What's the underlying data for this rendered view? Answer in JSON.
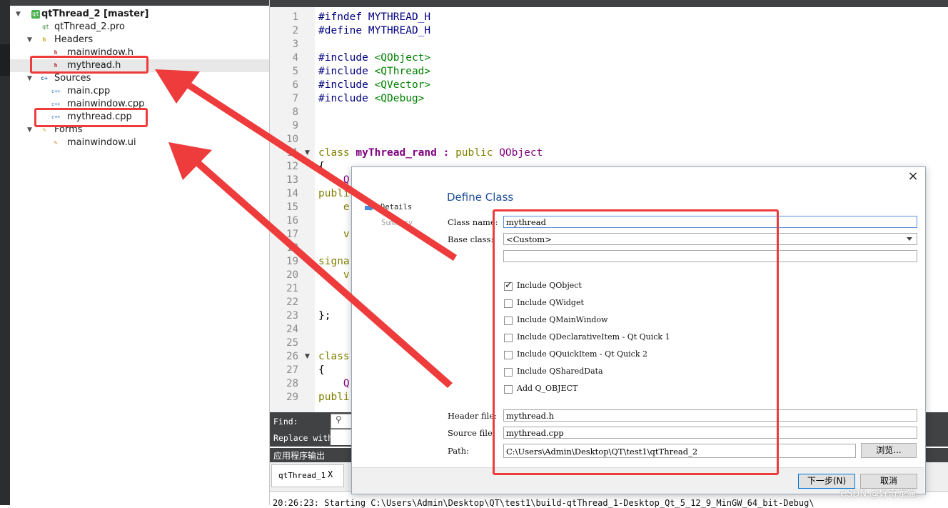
{
  "project_tree": {
    "root": "qtThread_2 [master]",
    "pro_file": "qtThread_2.pro",
    "headers_folder": "Headers",
    "headers": [
      "mainwindow.h",
      "mythread.h"
    ],
    "sources_folder": "Sources",
    "sources": [
      "main.cpp",
      "mainwindow.cpp",
      "mythread.cpp"
    ],
    "forms_folder": "Forms",
    "forms": [
      "mainwindow.ui"
    ]
  },
  "editor": {
    "line_numbers": [
      "1",
      "2",
      "3",
      "4",
      "5",
      "6",
      "7",
      "8",
      "9",
      "10",
      "11",
      "12",
      "13",
      "14",
      "15",
      "16",
      "17",
      "18",
      "19",
      "20",
      "21",
      "22",
      "23",
      "24",
      "25",
      "26",
      "27",
      "28",
      "29"
    ],
    "lines": {
      "l1_kw": "#ifndef",
      "l1_rest": " MYTHREAD_H",
      "l2_kw": "#define",
      "l2_rest": " MYTHREAD_H",
      "l4_kw": "#include",
      "l4_inc": " <QObject>",
      "l5_kw": "#include",
      "l5_inc": " <QThread>",
      "l6_kw": "#include",
      "l6_inc": " <QVector>",
      "l7_kw": "#include",
      "l7_inc": " <QDebug>",
      "l11_kw": "class",
      "l11_name": " myThread_rand",
      "l11_colon": " : ",
      "l11_pub": "public",
      "l11_base": " QObject",
      "l12": "{",
      "l13": "    Q",
      "l14": "publi",
      "l15": "    e",
      "l17": "    v",
      "l19": "signa",
      "l20": "    v",
      "l23": "};",
      "l26": "class",
      "l27": "{",
      "l28": "    Q",
      "l29": "publi"
    }
  },
  "find_bar": {
    "find_label": "Find:",
    "replace_label": "Replace with:"
  },
  "output_pane": {
    "title": "应用程序输出",
    "tab_label": "qtThread_1",
    "tab_close": "X",
    "text": "20:26:23: Starting C:\\Users\\Admin\\Desktop\\QT\\test1\\build-qtThread_1-Desktop_Qt_5_12_9_MinGW_64_bit-Debug\\"
  },
  "dialog": {
    "title": "Define Class",
    "close": "×",
    "steps": [
      "Details",
      "Summary"
    ],
    "class_name_label": "Class name:",
    "class_name_value": "mythread",
    "base_class_label": "Base class:",
    "base_class_value": "<Custom>",
    "custom_base_value": "",
    "checkboxes": [
      {
        "label": "Include QObject",
        "checked": true
      },
      {
        "label": "Include QWidget",
        "checked": false
      },
      {
        "label": "Include QMainWindow",
        "checked": false
      },
      {
        "label": "Include QDeclarativeItem - Qt Quick 1",
        "checked": false
      },
      {
        "label": "Include QQuickItem - Qt Quick 2",
        "checked": false
      },
      {
        "label": "Include QSharedData",
        "checked": false
      },
      {
        "label": "Add Q_OBJECT",
        "checked": false
      }
    ],
    "header_file_label": "Header file:",
    "header_file_value": "mythread.h",
    "source_file_label": "Source file:",
    "source_file_value": "mythread.cpp",
    "path_label": "Path:",
    "path_value": "C:\\Users\\Admin\\Desktop\\QT\\test1\\qtThread_2",
    "browse_button": "浏览...",
    "next_button": "下一步(N)",
    "cancel_button": "取消"
  },
  "watermark": "CSDN @好奇龙猫",
  "colors": {
    "annotation_red": "#ee3b3b",
    "dialog_title": "#1f4e99",
    "qt_dark": "#404244"
  }
}
